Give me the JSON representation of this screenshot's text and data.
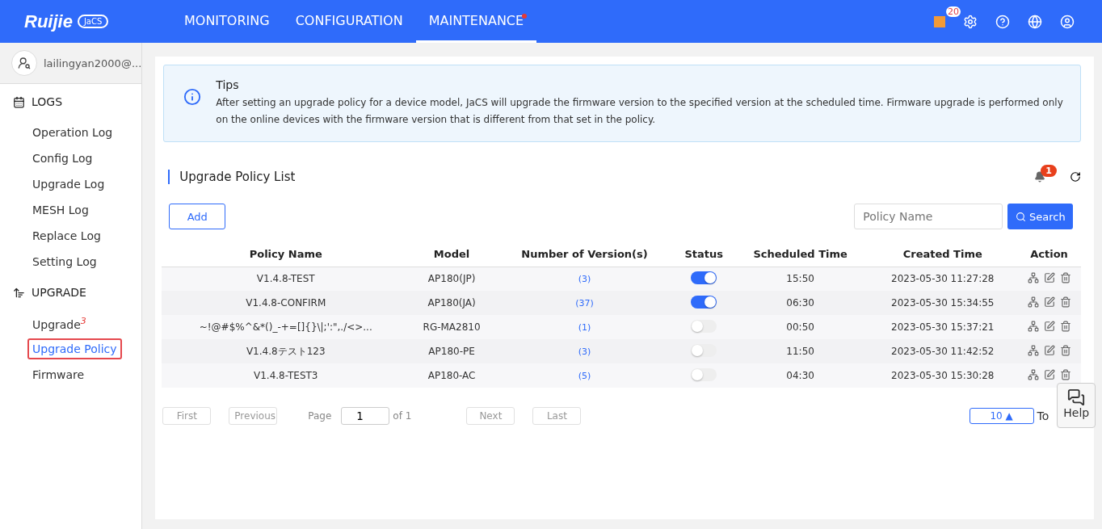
{
  "logo": {
    "brand": "Ruijie",
    "product": "JaCS"
  },
  "nav": [
    {
      "label": "MONITORING",
      "selected": false,
      "dot": false
    },
    {
      "label": "CONFIGURATION",
      "selected": false,
      "dot": false
    },
    {
      "label": "MAINTENANCE",
      "selected": true,
      "dot": true
    }
  ],
  "header_icons": {
    "alert_count": "20"
  },
  "user": {
    "name": "lailingyan2000@..."
  },
  "sidebar": [
    {
      "label": "LOGS",
      "children": [
        {
          "label": "Operation Log",
          "selected": false
        },
        {
          "label": "Config Log",
          "selected": false
        },
        {
          "label": "Upgrade Log",
          "selected": false
        },
        {
          "label": "MESH Log",
          "selected": false
        },
        {
          "label": "Replace Log",
          "selected": false
        },
        {
          "label": "Setting Log",
          "selected": false
        }
      ]
    },
    {
      "label": "UPGRADE",
      "children": [
        {
          "label": "Upgrade",
          "badge": "3",
          "selected": false
        },
        {
          "label": "Upgrade Policy",
          "selected": true
        },
        {
          "label": "Firmware",
          "selected": false
        }
      ]
    }
  ],
  "tips": {
    "title": "Tips",
    "text": "After setting an upgrade policy for a device model, JaCS will upgrade the firmware version to the specified version at the scheduled time. Firmware upgrade is performed only on the online devices with the firmware version that is different from that set in the policy."
  },
  "section_title": "Upgrade Policy List",
  "notification_count": "1",
  "add_button": "Add",
  "search": {
    "placeholder": "Policy Name",
    "button": "Search"
  },
  "table": {
    "columns": [
      "Policy Name",
      "Model",
      "Number of Version(s)",
      "Status",
      "Scheduled Time",
      "Created Time",
      "Action"
    ],
    "rows": [
      {
        "name": "V1.4.8-TEST",
        "model": "AP180(JP)",
        "versions": "(3)",
        "on": true,
        "scheduled": "15:50",
        "created": "2023-05-30 11:27:28"
      },
      {
        "name": "V1.4.8-CONFIRM",
        "model": "AP180(JA)",
        "versions": "(37)",
        "on": true,
        "scheduled": "06:30",
        "created": "2023-05-30 15:34:55"
      },
      {
        "name": "~!@#$%^&*()_-+=[]{}\\|;':\",./<>...",
        "model": "RG-MA2810",
        "versions": "(1)",
        "on": false,
        "scheduled": "00:50",
        "created": "2023-05-30 15:37:21"
      },
      {
        "name": "V1.4.8テスト123",
        "model": "AP180-PE",
        "versions": "(3)",
        "on": false,
        "scheduled": "11:50",
        "created": "2023-05-30 11:42:52"
      },
      {
        "name": "V1.4.8-TEST3",
        "model": "AP180-AC",
        "versions": "(5)",
        "on": false,
        "scheduled": "04:30",
        "created": "2023-05-30 15:30:28"
      }
    ]
  },
  "pagination": {
    "first": "First",
    "previous": "Previous",
    "page_label": "Page",
    "page": "1",
    "of": "of 1",
    "next": "Next",
    "last": "Last",
    "page_size": "10 ▲",
    "total": "To"
  },
  "help": "Help"
}
